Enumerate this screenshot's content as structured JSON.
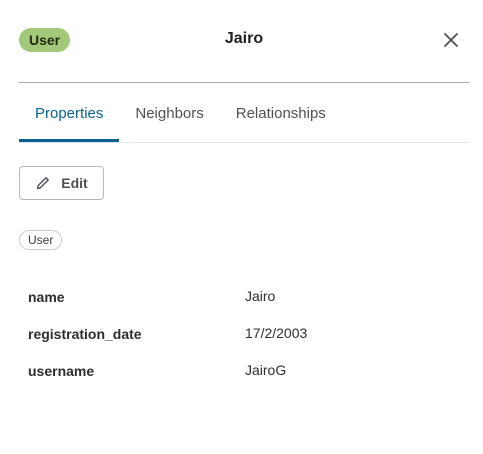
{
  "header": {
    "badge_label": "User",
    "badge_color": "#a2c97a",
    "title": "Jairo",
    "close_icon": "close-icon"
  },
  "tabs": [
    {
      "label": "Properties",
      "active": true
    },
    {
      "label": "Neighbors",
      "active": false
    },
    {
      "label": "Relationships",
      "active": false
    }
  ],
  "toolbar": {
    "edit_label": "Edit",
    "edit_icon": "pencil-icon"
  },
  "labels": [
    "User"
  ],
  "properties": [
    {
      "key": "name",
      "value": "Jairo"
    },
    {
      "key": "registration_date",
      "value": "17/2/2003"
    },
    {
      "key": "username",
      "value": "JairoG"
    }
  ],
  "colors": {
    "accent": "#0a6190",
    "divider": "#a8aaad"
  }
}
